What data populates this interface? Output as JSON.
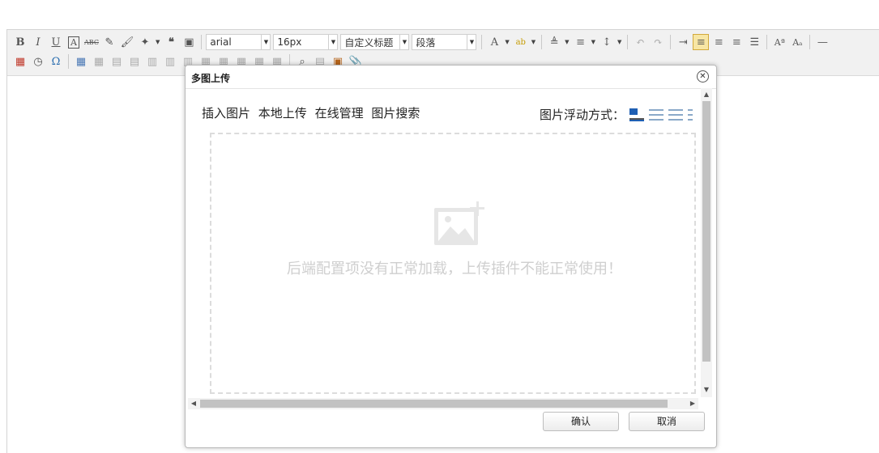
{
  "toolbar": {
    "font_family_value": "arial",
    "font_size_value": "16px",
    "custom_title_value": "自定义标题",
    "paragraph_value": "段落"
  },
  "dialog": {
    "title": "多图上传",
    "tabs": [
      "插入图片",
      "本地上传",
      "在线管理",
      "图片搜索"
    ],
    "float_label": "图片浮动方式：",
    "placeholder_message": "后端配置项没有正常加载，上传插件不能正常使用！",
    "confirm_label": "确认",
    "cancel_label": "取消"
  },
  "colors": {
    "active_highlight": "#f7e6a4",
    "placeholder_gray": "#cfcfcf"
  }
}
